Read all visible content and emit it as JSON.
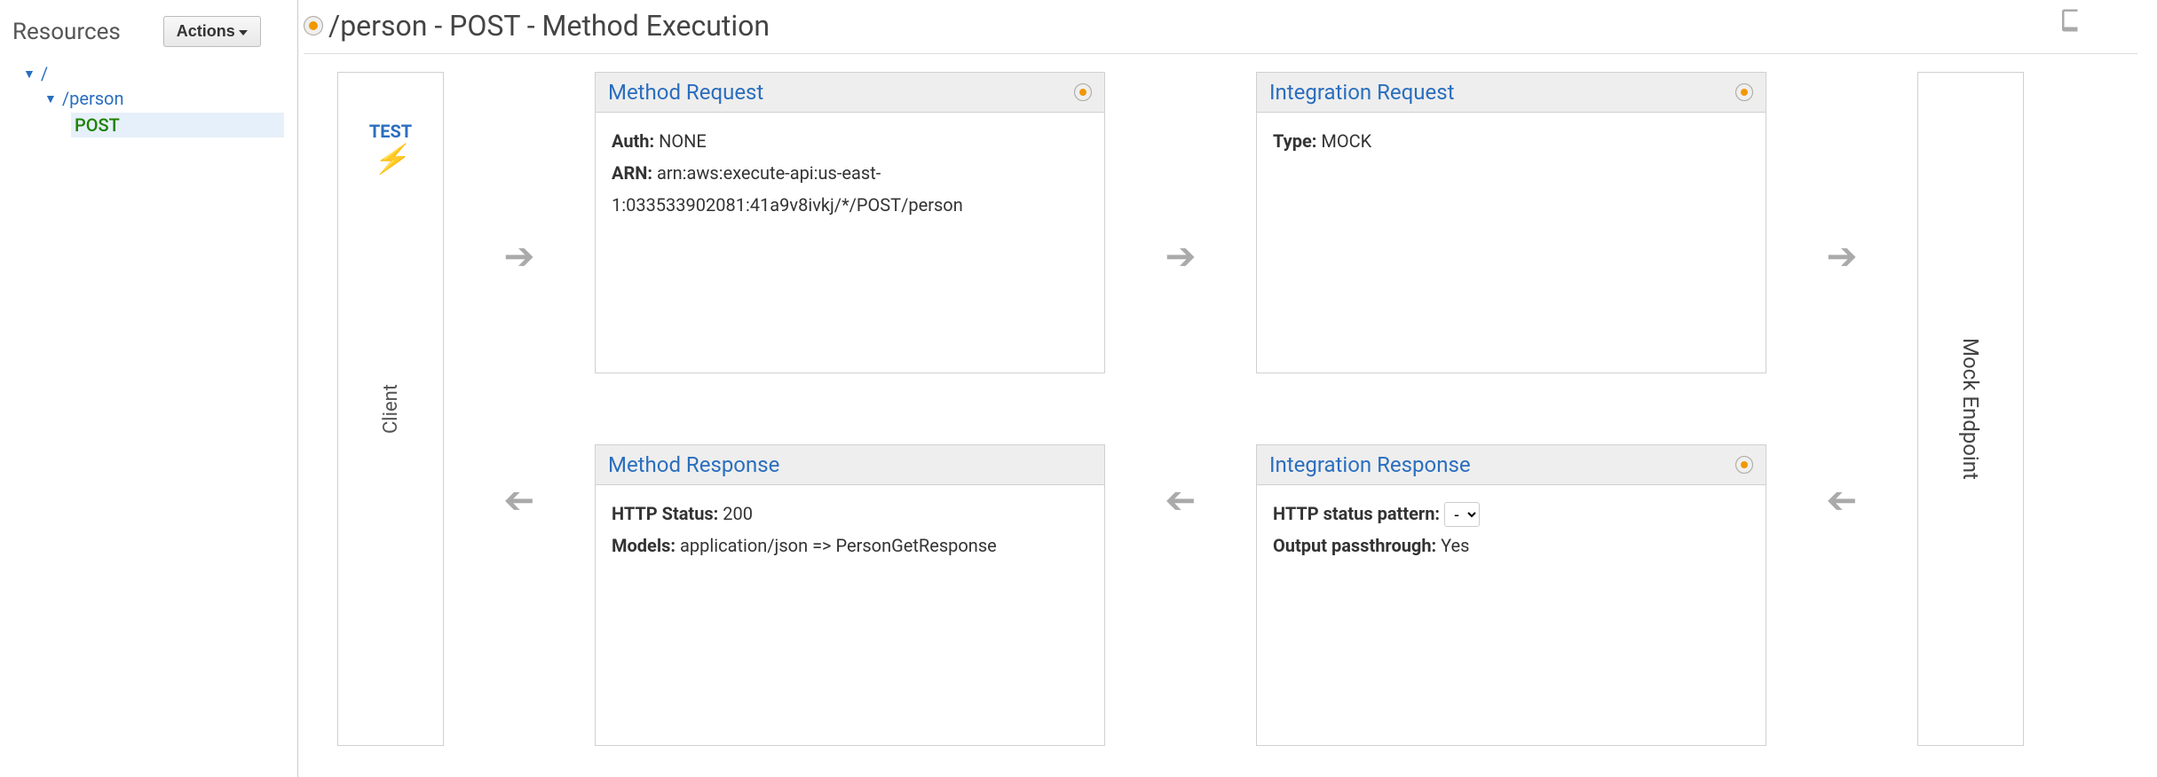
{
  "sidebar": {
    "title": "Resources",
    "actions_label": "Actions",
    "tree": {
      "root": "/",
      "resource": "/person",
      "method": "POST"
    }
  },
  "header": {
    "title": "/person - POST - Method Execution"
  },
  "client": {
    "label": "Client",
    "test_label": "TEST"
  },
  "endpoint": {
    "label": "Mock Endpoint"
  },
  "cards": {
    "method_request": {
      "title": "Method Request",
      "auth_label": "Auth:",
      "auth_value": "NONE",
      "arn_label": "ARN:",
      "arn_value": "arn:aws:execute-api:us-east-1:033533902081:41a9v8ivkj/*/POST/person"
    },
    "integration_request": {
      "title": "Integration Request",
      "type_label": "Type:",
      "type_value": "MOCK"
    },
    "method_response": {
      "title": "Method Response",
      "status_label": "HTTP Status:",
      "status_value": "200",
      "models_label": "Models:",
      "models_value": "application/json => PersonGetResponse"
    },
    "integration_response": {
      "title": "Integration Response",
      "pattern_label": "HTTP status pattern:",
      "pattern_value": "-",
      "passthrough_label": "Output passthrough:",
      "passthrough_value": "Yes"
    }
  }
}
